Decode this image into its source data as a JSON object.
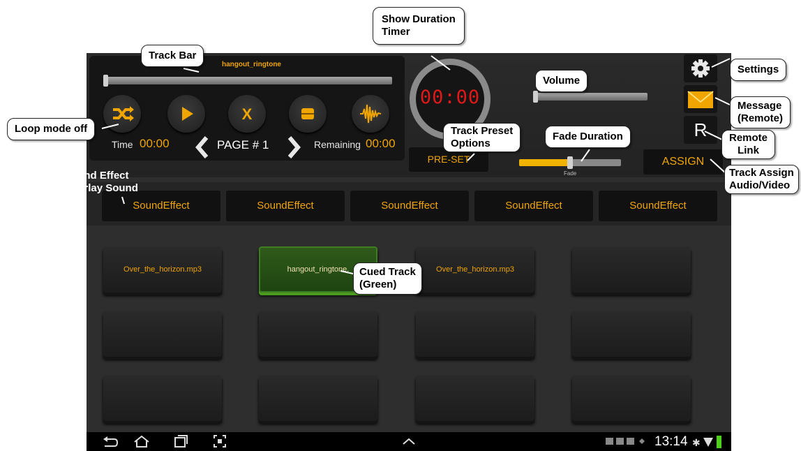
{
  "player": {
    "track_name": "hangout_ringtone",
    "time_label": "Time",
    "time_value": "00:00",
    "page_label": "PAGE # 1",
    "remaining_label": "Remaining",
    "remaining_value": "00:00",
    "track_progress": 0
  },
  "timer": {
    "value": "00:00"
  },
  "controls": {
    "preset_label": "PRE-SET",
    "assign_label": "ASSIGN",
    "fade_label": "Fade",
    "volume_level": 0,
    "fade_level": 0.5,
    "remote_letter": "R"
  },
  "sound_effects": [
    "SoundEffect",
    "SoundEffect",
    "SoundEffect",
    "SoundEffect",
    "SoundEffect"
  ],
  "tracks": [
    "Over_the_horizon.mp3",
    "hangout_ringtone.",
    "Over_the_horizon.mp3",
    "",
    "",
    "",
    "",
    "",
    "",
    "",
    "",
    ""
  ],
  "status_bar": {
    "clock": "13:14"
  },
  "callouts": {
    "track_bar": "Track Bar",
    "show_duration": [
      "Show Duration",
      "Timer"
    ],
    "settings": "Settings",
    "volume": "Volume",
    "message": [
      "Message",
      "(Remote)"
    ],
    "loop_mode": "Loop mode off",
    "track_preset": [
      "Track Preset",
      "Options"
    ],
    "fade_duration": "Fade Duration",
    "remote_link": [
      "Remote",
      "Link"
    ],
    "track_assign": [
      "Track Assign",
      "Audio/Video"
    ],
    "sound_effect": [
      "Sound Effect",
      "Overlay Sound"
    ],
    "cued_track": [
      "Cued Track",
      "(Green)"
    ]
  },
  "colors": {
    "accent": "#f0a500",
    "timer": "#e01818",
    "cued": "#2e5a1a",
    "background": "#2e2e2e"
  }
}
